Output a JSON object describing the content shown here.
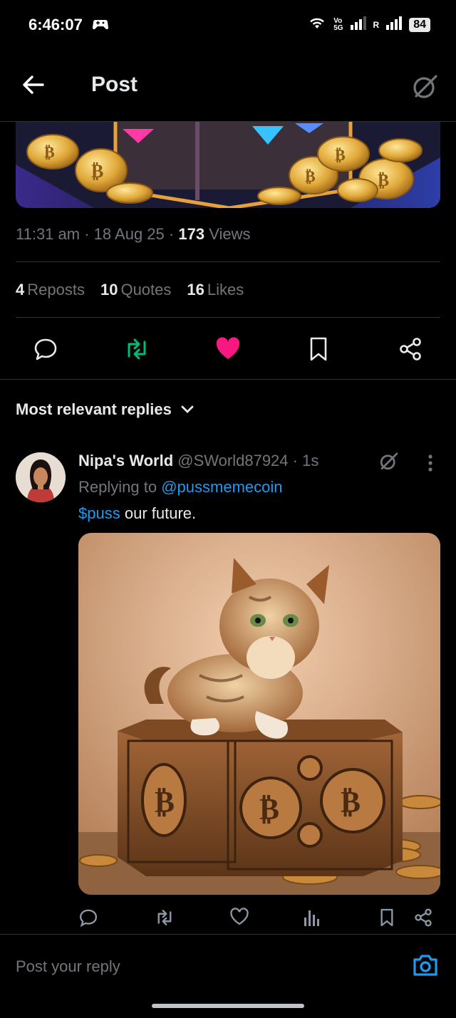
{
  "status_bar": {
    "time": "6:46:07",
    "net_top": "Vo",
    "net_bottom": "5G",
    "roaming": "R",
    "battery": "84"
  },
  "header": {
    "title": "Post"
  },
  "post": {
    "time": "11:31 am",
    "date": "18 Aug 25",
    "views_count": "173",
    "views_label": "Views",
    "reposts_count": "4",
    "reposts_label": "Reposts",
    "quotes_count": "10",
    "quotes_label": "Quotes",
    "likes_count": "16",
    "likes_label": "Likes"
  },
  "replies": {
    "sort_label": "Most relevant replies",
    "items": [
      {
        "name": "Nipa's World",
        "handle": "@SWorld87924",
        "age": "1s",
        "replying_prefix": "Replying to",
        "replying_to": "@pussmemecoin",
        "cashtag": "$puss",
        "text": "our future."
      }
    ]
  },
  "composer": {
    "placeholder": "Post your reply"
  },
  "colors": {
    "accent": "#1d9bf0",
    "repost": "#00ba7c",
    "like": "#f91880",
    "muted": "#71767b"
  }
}
